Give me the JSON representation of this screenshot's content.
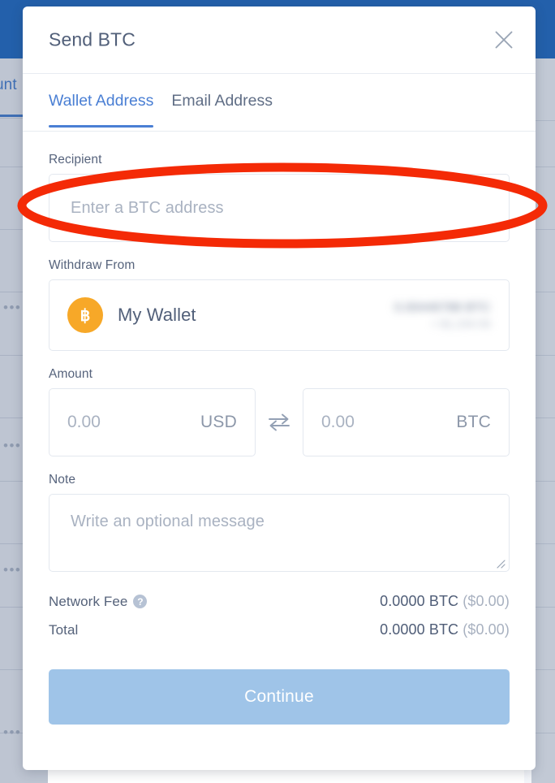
{
  "backdrop": {
    "nav_label": "unt",
    "row_dots": "•••"
  },
  "modal": {
    "title": "Send BTC",
    "close_icon": "close-icon",
    "tabs": [
      {
        "label": "Wallet Address",
        "active": true
      },
      {
        "label": "Email Address",
        "active": false
      }
    ],
    "recipient": {
      "label": "Recipient",
      "value": "",
      "placeholder": "Enter a BTC address"
    },
    "withdraw_from": {
      "label": "Withdraw From",
      "coin_icon": "bitcoin-icon",
      "coin_symbol": "฿",
      "wallet_name": "My Wallet",
      "balance_primary": "0.00446788 BTC",
      "balance_secondary": "≈ $1,234.56",
      "balance_redacted": true
    },
    "amount": {
      "label": "Amount",
      "fiat_value": "",
      "fiat_placeholder": "0.00",
      "fiat_currency": "USD",
      "swap_icon": "swap-arrows-icon",
      "crypto_value": "",
      "crypto_placeholder": "0.00",
      "crypto_currency": "BTC"
    },
    "note": {
      "label": "Note",
      "value": "",
      "placeholder": "Write an optional message",
      "resize_handle_icon": "resize-handle-icon"
    },
    "summary": [
      {
        "label": "Network Fee",
        "has_help": true,
        "help_icon": "help-icon",
        "help_glyph": "?",
        "amount": "0.0000 BTC",
        "fiat": "($0.00)"
      },
      {
        "label": "Total",
        "has_help": false,
        "amount": "0.0000 BTC",
        "fiat": "($0.00)"
      }
    ],
    "continue_label": "Continue"
  },
  "annotation": {
    "shape": "ellipse",
    "color": "#f42a06",
    "stroke_width": 9
  },
  "colors": {
    "accent_blue": "#4a7fd4",
    "topbar_blue": "#2360ab",
    "backdrop_grey": "#bec5d2",
    "bitcoin_orange": "#f7a828",
    "continue_blue": "#9fc4e8",
    "annotation_red": "#f42a06",
    "title_slate": "#515f79",
    "placeholder_grey": "#a9b2c1"
  }
}
